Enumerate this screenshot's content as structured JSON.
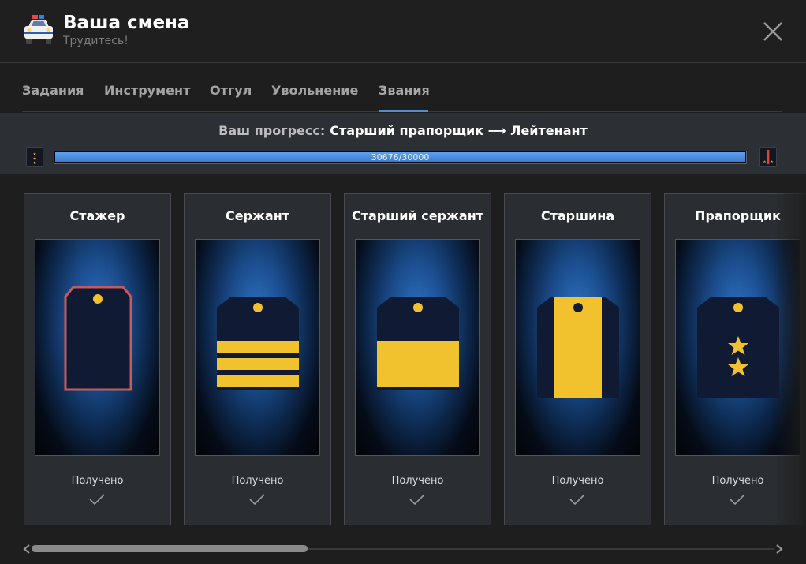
{
  "header": {
    "title": "Ваша смена",
    "subtitle": "Трудитесь!",
    "icon": "police-car-icon"
  },
  "tabs": [
    {
      "label": "Задания"
    },
    {
      "label": "Инструмент"
    },
    {
      "label": "Отгул"
    },
    {
      "label": "Увольнение"
    },
    {
      "label": "Звания",
      "active": true
    }
  ],
  "progress": {
    "label": "Ваш прогресс:",
    "ranks_text": "Старший прапорщик ⟶ Лейтенант",
    "value_text": "30676/30000",
    "current": 30676,
    "target": 30000,
    "fill_fraction": 1.0
  },
  "ranks": [
    {
      "title": "Стажер",
      "status": "Получено",
      "insignia": "empty-outlined"
    },
    {
      "title": "Сержант",
      "status": "Получено",
      "insignia": "three-stripes"
    },
    {
      "title": "Старший сержант",
      "status": "Получено",
      "insignia": "wide-stripe"
    },
    {
      "title": "Старшина",
      "status": "Получено",
      "insignia": "vertical-stripe"
    },
    {
      "title": "Прапорщик",
      "status": "Получено",
      "insignia": "two-stars"
    }
  ],
  "colors": {
    "accent": "#4a90d9",
    "gold": "#f2c12e",
    "navy": "#111a33",
    "outline_red": "#c85a5a"
  }
}
